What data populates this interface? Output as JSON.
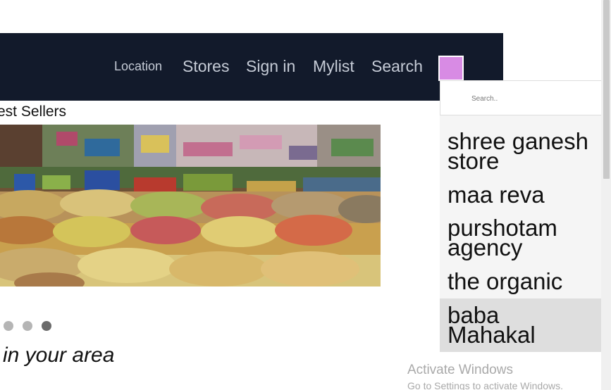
{
  "nav": {
    "location": "Location",
    "stores": "Stores",
    "signin": "Sign in",
    "mylist": "Mylist",
    "search": "Search"
  },
  "section_title": "est Sellers",
  "tagline": "in your area",
  "search": {
    "placeholder": "Search.."
  },
  "dropdown": {
    "items": [
      {
        "line1": "shree ganesh",
        "line2": "store"
      },
      {
        "line1": "maa reva",
        "line2": ""
      },
      {
        "line1": "purshotam",
        "line2": "agency"
      },
      {
        "line1": "the organic",
        "line2": ""
      },
      {
        "line1": "baba",
        "line2": "Mahakal"
      }
    ]
  },
  "carousel": {
    "slide_count": 3,
    "active_index": 2
  },
  "watermark": {
    "title": "Activate Windows",
    "subtitle": "Go to Settings to activate Windows."
  },
  "colors": {
    "navbar_bg": "#121a2b",
    "nav_text": "#c5cbd6",
    "toggle_button": "#d88be4",
    "dropdown_bg": "#f5f5f5",
    "dropdown_highlight": "#dedede"
  }
}
